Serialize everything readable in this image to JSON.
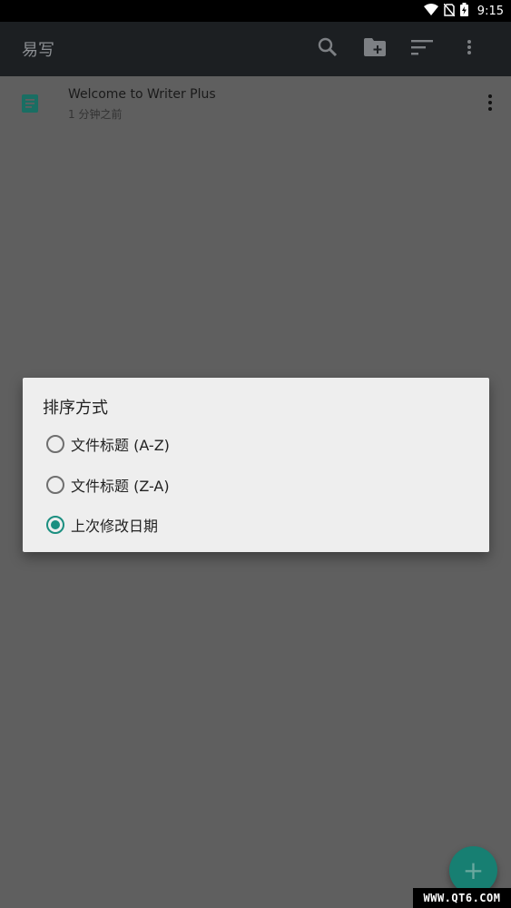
{
  "status_bar": {
    "time": "9:15",
    "icons": [
      "wifi-icon",
      "no-sim-icon",
      "battery-charging-icon"
    ]
  },
  "app_bar": {
    "title": "易写",
    "actions": [
      "search-icon",
      "new-folder-icon",
      "sort-icon",
      "more-vert-icon"
    ]
  },
  "documents": [
    {
      "title": "Welcome to Writer Plus",
      "subtitle": "1 分钟之前",
      "icon": "document-icon"
    }
  ],
  "sort_dialog": {
    "title": "排序方式",
    "options": [
      {
        "label": "文件标题 (A-Z)",
        "selected": false
      },
      {
        "label": "文件标题 (Z-A)",
        "selected": false
      },
      {
        "label": "上次修改日期",
        "selected": true
      }
    ]
  },
  "fab": {
    "label": "+",
    "icon": "add-icon"
  },
  "watermark": {
    "text": "WWW.QT6.COM"
  },
  "colors": {
    "accent": "#1b8f80",
    "app_bar": "#1c1f22",
    "scrim_background": "#5f5f5f",
    "dialog": "#eeeeee"
  }
}
